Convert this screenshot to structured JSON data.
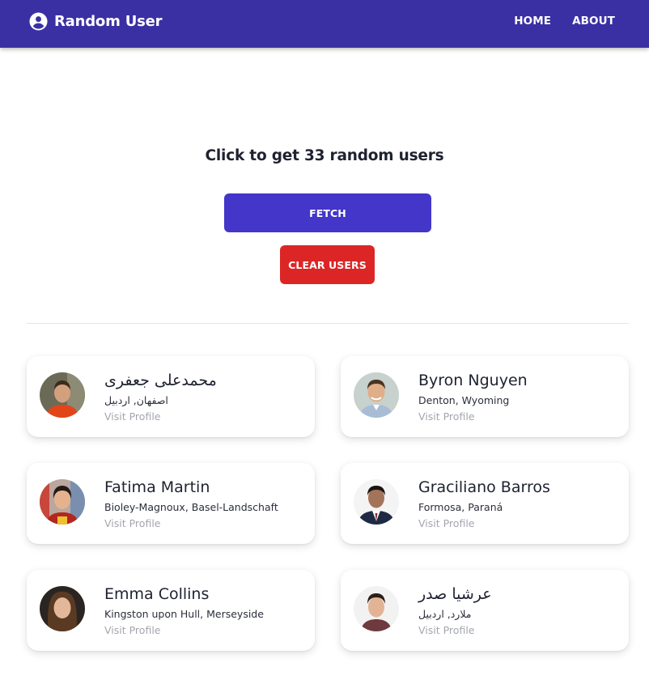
{
  "app": {
    "title": "Random User",
    "nav": [
      {
        "label": "HOME"
      },
      {
        "label": "ABOUT"
      }
    ]
  },
  "main": {
    "heading": "Click to get 33 random users",
    "fetch_label": "FETCH",
    "clear_label": "CLEAR USERS"
  },
  "users": [
    {
      "name": "محمدعلی جعفری",
      "location": "اصفهان, اردبیل",
      "link": "Visit Profile"
    },
    {
      "name": "Byron Nguyen",
      "location": "Denton, Wyoming",
      "link": "Visit Profile"
    },
    {
      "name": "Fatima Martin",
      "location": "Bioley-Magnoux, Basel-Landschaft",
      "link": "Visit Profile"
    },
    {
      "name": "Graciliano Barros",
      "location": "Formosa, Paraná",
      "link": "Visit Profile"
    },
    {
      "name": "Emma Collins",
      "location": "Kingston upon Hull, Merseyside",
      "link": "Visit Profile"
    },
    {
      "name": "عرشيا صدر",
      "location": "ملارد, اردبیل",
      "link": "Visit Profile"
    }
  ],
  "colors": {
    "appbar": "#3a30a4",
    "fetch_button": "#4336c8",
    "clear_button": "#dc2626",
    "link_text": "#a3a6ae"
  },
  "icons": {
    "brand": "account-circle-icon"
  }
}
